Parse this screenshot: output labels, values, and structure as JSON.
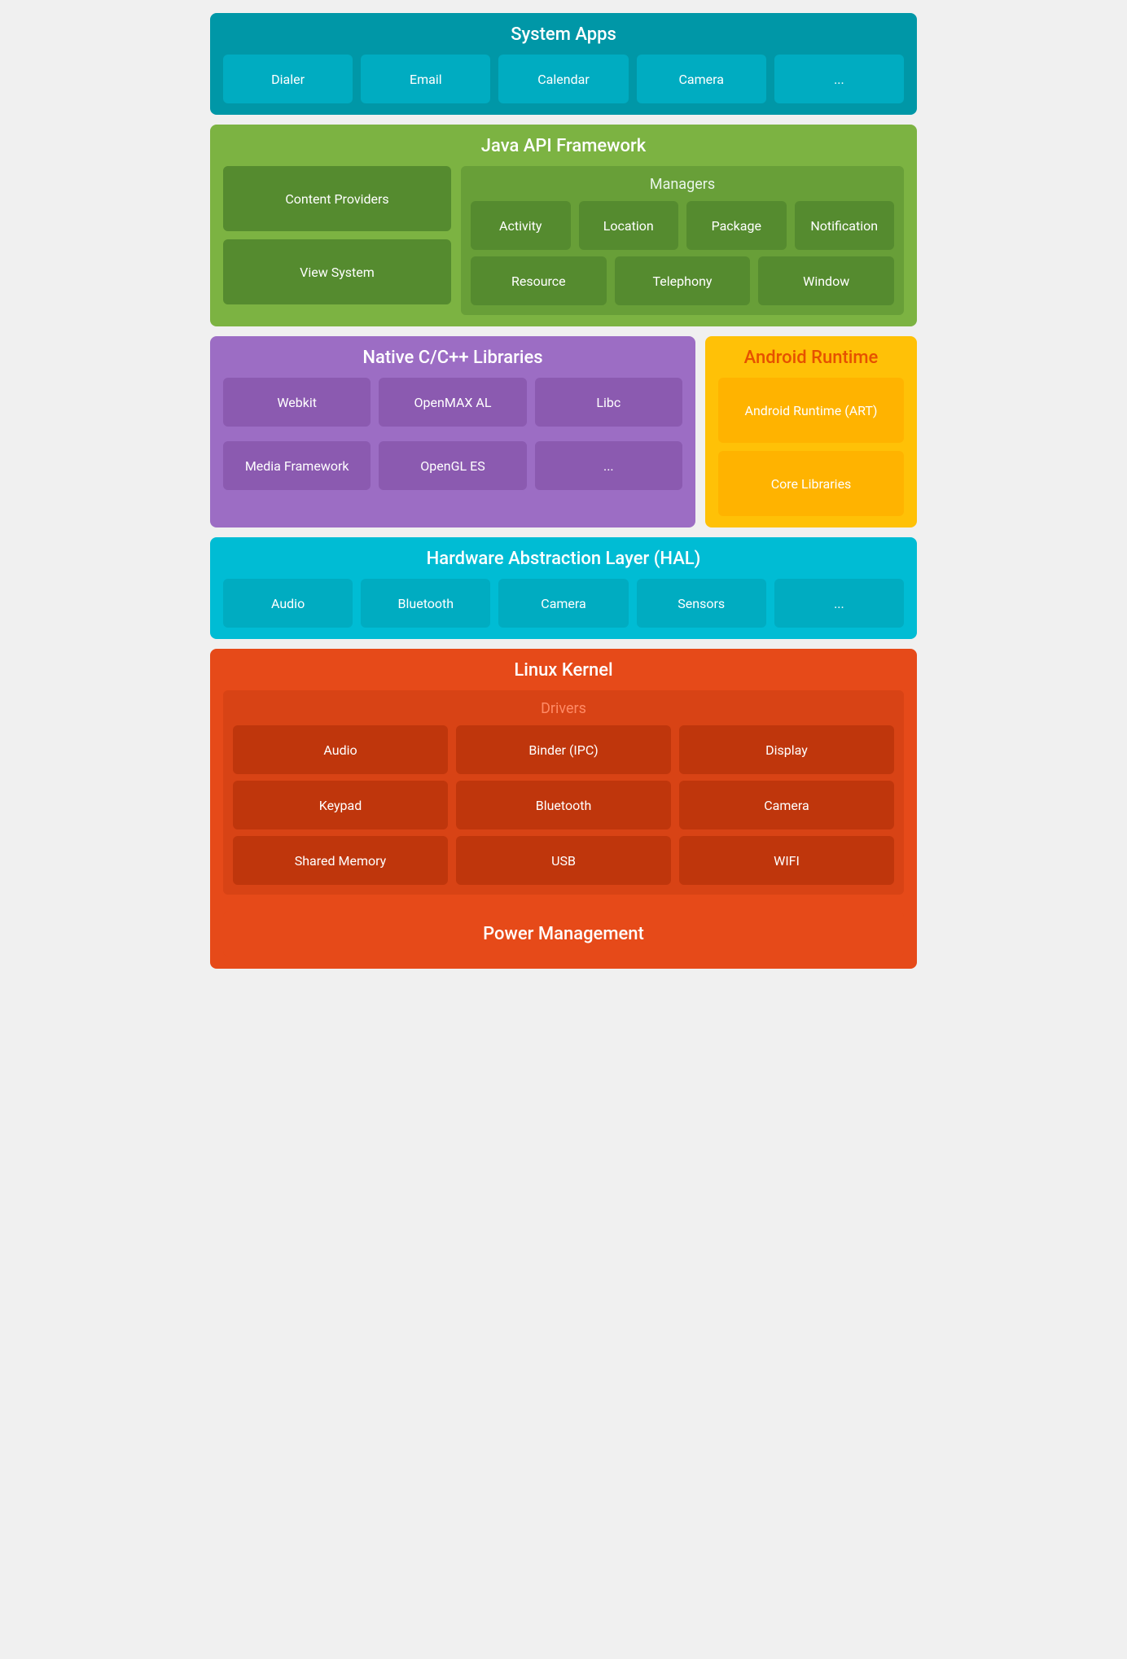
{
  "system_apps": {
    "title": "System Apps",
    "tiles": [
      "Dialer",
      "Email",
      "Calendar",
      "Camera",
      "..."
    ]
  },
  "java_api": {
    "title": "Java API Framework",
    "left": {
      "items": [
        "Content Providers",
        "View System"
      ]
    },
    "right": {
      "managers_title": "Managers",
      "row1": [
        "Activity",
        "Location",
        "Package",
        "Notification"
      ],
      "row2": [
        "Resource",
        "Telephony",
        "Window"
      ]
    }
  },
  "native": {
    "title": "Native C/C++ Libraries",
    "row1": [
      "Webkit",
      "OpenMAX AL",
      "Libc"
    ],
    "row2": [
      "Media Framework",
      "OpenGL ES",
      "..."
    ]
  },
  "android_runtime": {
    "title": "Android Runtime",
    "tiles": [
      "Android Runtime (ART)",
      "Core Libraries"
    ]
  },
  "hal": {
    "title": "Hardware Abstraction Layer (HAL)",
    "tiles": [
      "Audio",
      "Bluetooth",
      "Camera",
      "Sensors",
      "..."
    ]
  },
  "linux": {
    "title": "Linux Kernel",
    "drivers_title": "Drivers",
    "row1": [
      "Audio",
      "Binder (IPC)",
      "Display"
    ],
    "row2": [
      "Keypad",
      "Bluetooth",
      "Camera"
    ],
    "row3": [
      "Shared Memory",
      "USB",
      "WIFI"
    ]
  },
  "power": {
    "title": "Power Management"
  }
}
